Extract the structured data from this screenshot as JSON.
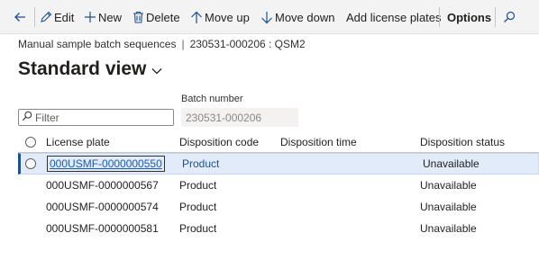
{
  "toolbar": {
    "back_label": "",
    "edit_label": "Edit",
    "new_label": "New",
    "delete_label": "Delete",
    "move_up_label": "Move up",
    "move_down_label": "Move down",
    "add_license_plates_label": "Add license plates",
    "options_label": "Options",
    "icons": {
      "back": "back-arrow-icon",
      "edit": "pencil-icon",
      "new": "plus-icon",
      "delete": "trash-icon",
      "move_up": "arrow-up-icon",
      "move_down": "arrow-down-icon",
      "search": "search-icon"
    }
  },
  "caption": {
    "form_name": "Manual sample batch sequences",
    "separator": "|",
    "record": "230531-000206 : QSM2"
  },
  "view": {
    "title": "Standard view"
  },
  "filter": {
    "placeholder": "Filter",
    "value": ""
  },
  "batch": {
    "label": "Batch number",
    "value": "230531-000206"
  },
  "grid": {
    "columns": [
      "License plate",
      "Disposition code",
      "Disposition time",
      "Disposition status"
    ],
    "rows": [
      {
        "license_plate": "000USMF-0000000550",
        "disposition_code": "Product",
        "disposition_time": "",
        "disposition_status": "Unavailable",
        "selected": true
      },
      {
        "license_plate": "000USMF-0000000567",
        "disposition_code": "Product",
        "disposition_time": "",
        "disposition_status": "Unavailable",
        "selected": false
      },
      {
        "license_plate": "000USMF-0000000574",
        "disposition_code": "Product",
        "disposition_time": "",
        "disposition_status": "Unavailable",
        "selected": false
      },
      {
        "license_plate": "000USMF-0000000581",
        "disposition_code": "Product",
        "disposition_time": "",
        "disposition_status": "Unavailable",
        "selected": false
      }
    ]
  },
  "colors": {
    "accent": "#1d4f91",
    "link": "#1c5bb0",
    "selected_row": "#e1ebf9",
    "toolbar_bg": "#f3f3f3"
  }
}
